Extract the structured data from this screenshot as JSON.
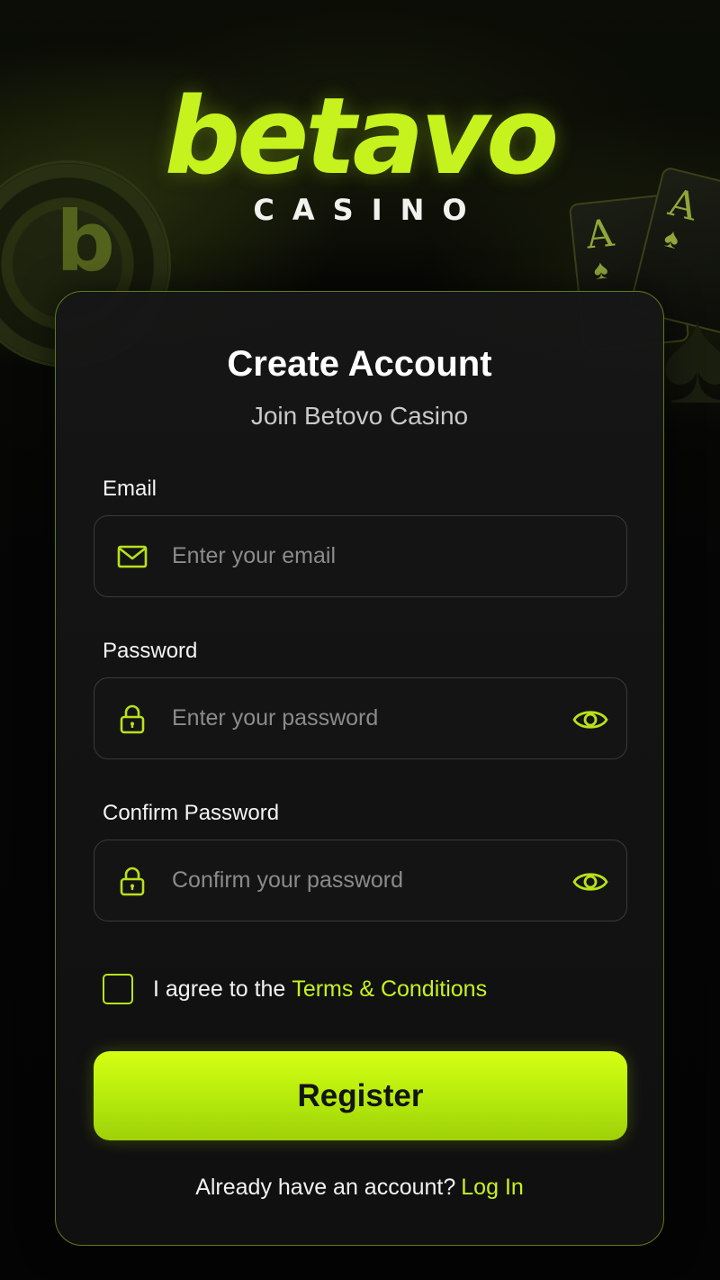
{
  "brand": {
    "name": "betavo",
    "tagline": "CASINO",
    "chip_letter": "b",
    "card_rank": "A",
    "accent_color": "#c6f21e"
  },
  "form": {
    "title": "Create Account",
    "subtitle": "Join Betovo Casino",
    "email": {
      "label": "Email",
      "placeholder": "Enter your email",
      "value": "",
      "icon": "mail-icon"
    },
    "password": {
      "label": "Password",
      "placeholder": "Enter your password",
      "value": "",
      "icon": "lock-icon",
      "toggle_icon": "eye-icon"
    },
    "confirm_password": {
      "label": "Confirm Password",
      "placeholder": "Confirm your password",
      "value": "",
      "icon": "lock-icon",
      "toggle_icon": "eye-icon"
    },
    "agree": {
      "text": "I agree to the",
      "link": "Terms & Conditions",
      "checked": false
    },
    "submit_label": "Register",
    "footer": {
      "question": "Already have an account?",
      "link": "Log In"
    }
  }
}
